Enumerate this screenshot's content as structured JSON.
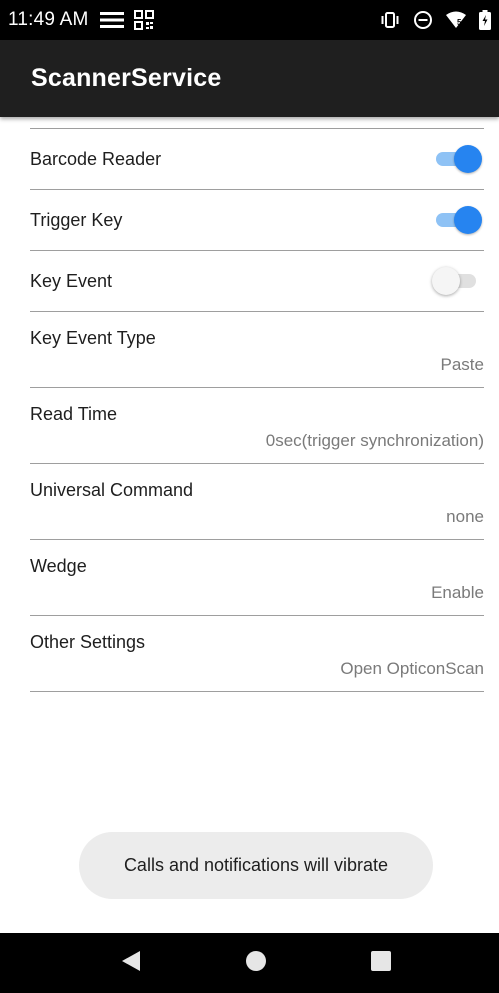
{
  "status_bar": {
    "time": "11:49 AM",
    "icons": [
      "notification-menu-icon",
      "qr-code-icon",
      "vibrate-icon",
      "do-not-disturb-icon",
      "wifi-icon",
      "battery-icon"
    ],
    "wifi_badge": "5"
  },
  "app_bar": {
    "title": "ScannerService"
  },
  "settings": {
    "barcode_reader": {
      "label": "Barcode Reader",
      "enabled": true
    },
    "trigger_key": {
      "label": "Trigger Key",
      "enabled": true
    },
    "key_event": {
      "label": "Key Event",
      "enabled": false
    },
    "key_event_type": {
      "label": "Key Event Type",
      "value": "Paste"
    },
    "read_time": {
      "label": "Read Time",
      "value": "0sec(trigger synchronization)"
    },
    "universal_command": {
      "label": "Universal Command",
      "value": "none"
    },
    "wedge": {
      "label": "Wedge",
      "value": "Enable"
    },
    "other_settings": {
      "label": "Other Settings",
      "value": "Open OpticonScan"
    }
  },
  "toast": {
    "message": "Calls and notifications will vibrate"
  },
  "nav_bar": {
    "buttons": [
      "back-icon",
      "home-icon",
      "recents-icon"
    ]
  },
  "colors": {
    "accent": "#2684f0",
    "accent_track": "#8ec2f5",
    "app_bar": "#1f1f1f",
    "status_bar": "#000000",
    "divider": "#9e9e9e",
    "secondary_text": "#7a7a7a",
    "toast_bg": "#ececec"
  }
}
